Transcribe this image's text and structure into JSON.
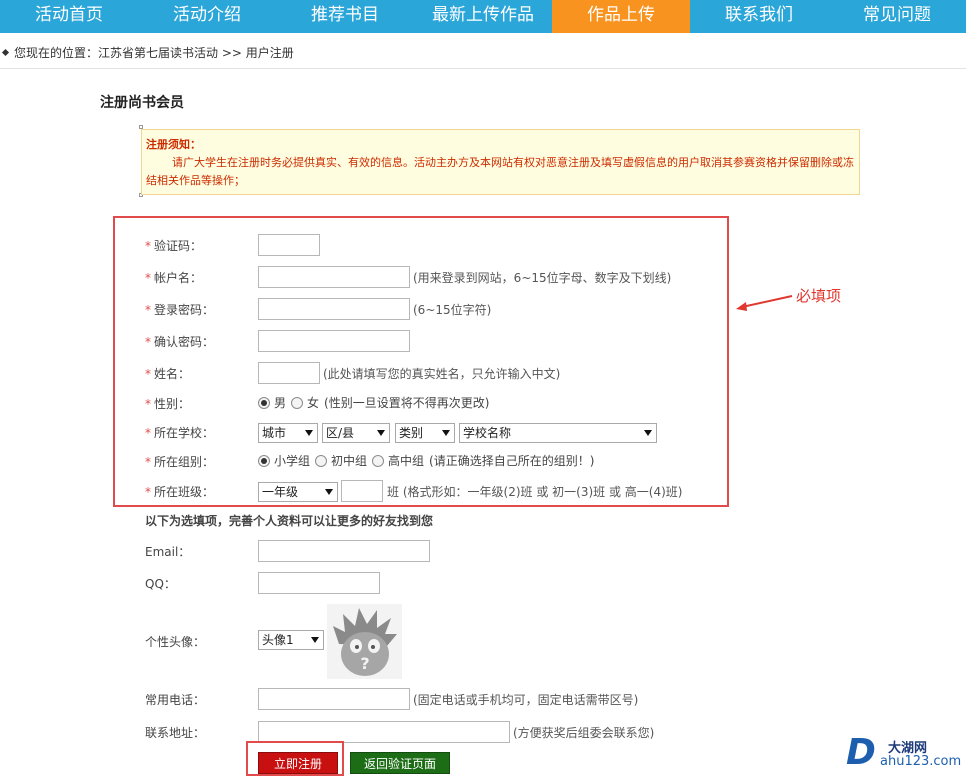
{
  "nav": {
    "items": [
      "活动首页",
      "活动介绍",
      "推荐书目",
      "最新上传作品",
      "作品上传",
      "联系我们",
      "常见问题"
    ],
    "active_index": 4
  },
  "breadcrumb": {
    "prefix": "您现在的位置：",
    "parent": "江苏省第七届读书活动",
    "separator": " >> ",
    "current": "用户注册"
  },
  "page_title": "注册尚书会员",
  "notice": {
    "title": "注册须知：",
    "body": "请广大学生在注册时务必提供真实、有效的信息。活动主办方及本网站有权对恶意注册及填写虚假信息的用户取消其参赛资格并保留删除或冻结相关作品等操作；"
  },
  "annotation": {
    "label": "必填项"
  },
  "required": {
    "star": "*",
    "captcha": {
      "label": "验证码：",
      "value": ""
    },
    "account": {
      "label": "帐户名：",
      "value": "",
      "hint": "(用来登录到网站，6~15位字母、数字及下划线)"
    },
    "password": {
      "label": "登录密码：",
      "value": "",
      "hint": "(6~15位字符)"
    },
    "confirm": {
      "label": "确认密码：",
      "value": ""
    },
    "name": {
      "label": "姓名：",
      "value": "",
      "hint": "(此处请填写您的真实姓名，只允许输入中文)"
    },
    "gender": {
      "label": "性别：",
      "male": "男",
      "female": "女",
      "hint": "(性别一旦设置将不得再次更改)",
      "selected": "男"
    },
    "school": {
      "label": "所在学校：",
      "city": "城市",
      "district": "区/县",
      "category": "类别",
      "school_name": "学校名称"
    },
    "group": {
      "label": "所在组别：",
      "primary": "小学组",
      "junior": "初中组",
      "senior": "高中组",
      "hint": "(请正确选择自己所在的组别！)",
      "selected": "小学组"
    },
    "klass": {
      "label": "所在班级：",
      "grade": "一年级",
      "value": "",
      "unit": "班",
      "hint": "(格式形如：一年级(2)班 或 初一(3)班 或 高一(4)班)"
    }
  },
  "optional": {
    "title": "以下为选填项，完善个人资料可以让更多的好友找到您",
    "email": {
      "label": "Email：",
      "value": ""
    },
    "qq": {
      "label": "QQ：",
      "value": ""
    },
    "avatar": {
      "label": "个性头像：",
      "selected": "头像1"
    },
    "phone": {
      "label": "常用电话：",
      "value": "",
      "hint": "(固定电话或手机均可，固定电话需带区号)"
    },
    "address": {
      "label": "联系地址：",
      "value": "",
      "hint": "(方便获奖后组委会联系您)"
    }
  },
  "buttons": {
    "register": "立即注册",
    "back": "返回验证页面"
  },
  "watermark": {
    "brand": "大湖网",
    "url": "ahu123.com"
  },
  "colors": {
    "nav_bg": "#2ba6d9",
    "nav_active": "#f7931e",
    "annotation_red": "#e24b4b",
    "register_btn": "#c91010",
    "back_btn": "#1c6d16"
  }
}
